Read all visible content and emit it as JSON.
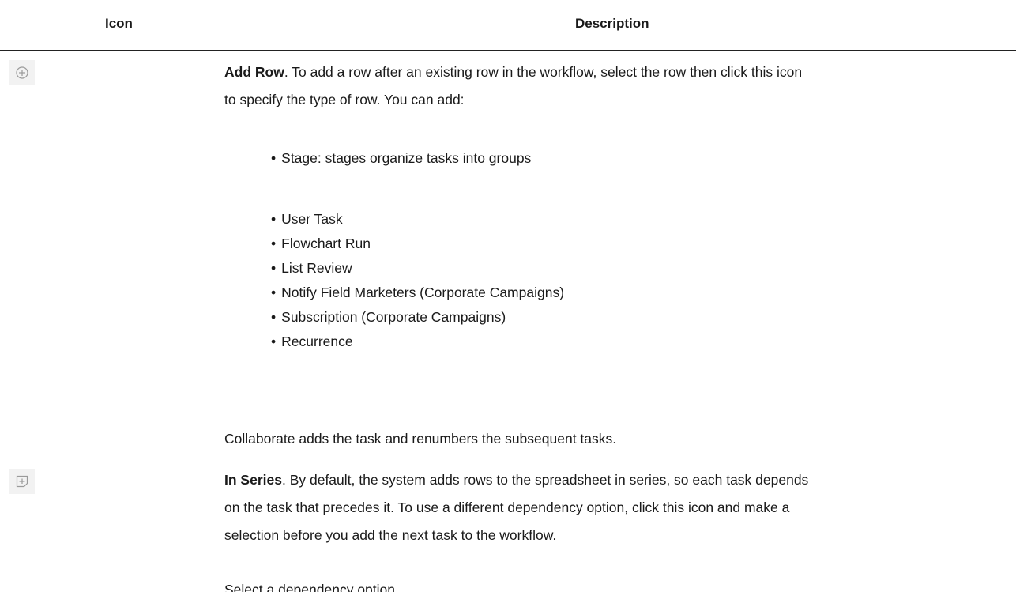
{
  "table": {
    "headers": {
      "icon": "Icon",
      "description": "Description"
    },
    "rows": [
      {
        "icon": "add-row-icon",
        "title": "Add Row",
        "lines": [
          ". To add a row after an existing row in the workflow, select the row then click this icon",
          "to specify the type of row. You can add:"
        ],
        "stage_bullet": "Stage: stages organize tasks into groups",
        "bullets": [
          "User Task",
          "Flowchart Run",
          "List Review",
          "Notify Field Marketers (Corporate Campaigns)",
          "Subscription (Corporate Campaigns)",
          "Recurrence"
        ],
        "footer": "Collaborate adds the task and renumbers the subsequent tasks."
      },
      {
        "icon": "in-series-icon",
        "title": "In Series",
        "lines": [
          ". By default, the system adds rows to the spreadsheet in series, so each task depends",
          "on the task that precedes it. To use a different dependency option, click this icon and make a",
          "selection before you add the next task to the workflow."
        ],
        "footer": "Select a dependency option."
      }
    ]
  },
  "colors": {
    "text": "#1a1a1a",
    "icon_background": "#f2f2f2",
    "icon_stroke": "#9a9a9a",
    "header_rule": "#222222"
  }
}
